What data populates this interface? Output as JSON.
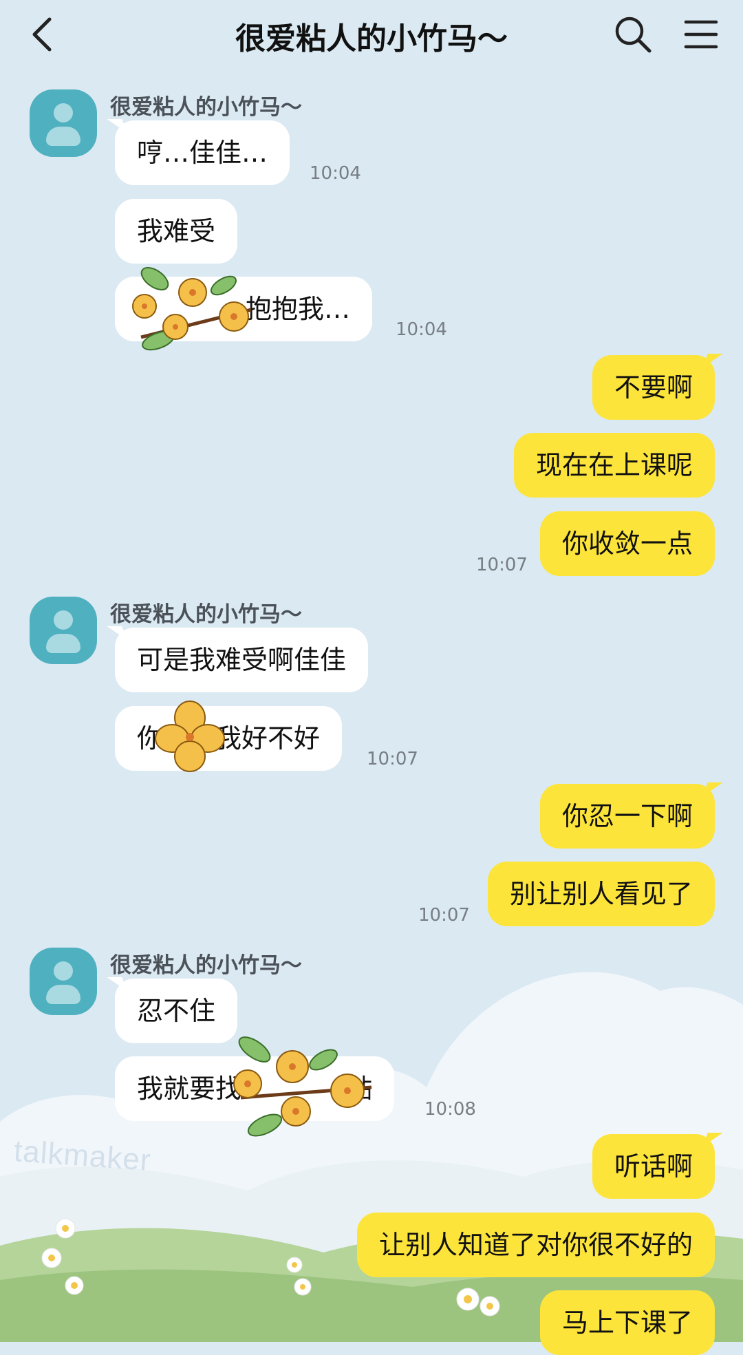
{
  "header": {
    "title": "很爱粘人的小竹马～",
    "icons": [
      "back-arrow-icon",
      "search-icon",
      "menu-icon"
    ]
  },
  "contact": {
    "name": "很爱粘人的小竹马～"
  },
  "messages": [
    {
      "from": "contact",
      "text": "哼…佳佳…",
      "time": "10:04"
    },
    {
      "from": "contact",
      "text": "我难受"
    },
    {
      "from": "contact",
      "text": "抱抱我…",
      "time": "10:04",
      "partially_covered": true
    },
    {
      "from": "me",
      "text": "不要啊"
    },
    {
      "from": "me",
      "text": "现在在上课呢"
    },
    {
      "from": "me",
      "text": "你收敛一点",
      "time": "10:07"
    },
    {
      "from": "contact",
      "text": "可是我难受啊佳佳"
    },
    {
      "from": "contact",
      "text": "你  我好不好",
      "time": "10:07",
      "partially_covered": true
    },
    {
      "from": "me",
      "text": "你忍一下啊"
    },
    {
      "from": "me",
      "text": "别让别人看见了",
      "time": "10:07"
    },
    {
      "from": "contact",
      "text": "忍不住"
    },
    {
      "from": "contact",
      "text": "我就要找    贴",
      "time": "10:08",
      "partially_covered": true
    },
    {
      "from": "me",
      "text": "听话啊"
    },
    {
      "from": "me",
      "text": "让别人知道了对你很不好的"
    },
    {
      "from": "me",
      "text": "马上下课了"
    }
  ],
  "watermark": "talkmaker",
  "colors": {
    "background": "#dbe9f2",
    "outgoing_bubble": "#fde43a",
    "incoming_bubble": "#ffffff",
    "avatar": "#4fb0bf",
    "timestamp": "#777d84"
  },
  "stickers": [
    "osmanthus-flower-sticker",
    "osmanthus-flower-sticker",
    "osmanthus-flower-sticker"
  ]
}
